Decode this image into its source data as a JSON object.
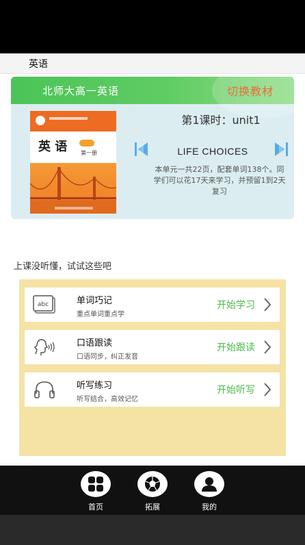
{
  "header": {
    "title": "英语"
  },
  "book": {
    "name": "北师大高一英语",
    "switch_label": "切换教材",
    "cover": {
      "title": "英 语",
      "volume": "第一册"
    },
    "lesson_title": "第1课时：unit1",
    "unit_name": "LIFE CHOICES",
    "description": "本单元一共22页，配套单词138个。同学们可以花17天来学习，并预留1到2天复习"
  },
  "practice": {
    "prompt": "上课没听懂，试试这些吧",
    "items": [
      {
        "title": "单词巧记",
        "subtitle": "重点单词重点学",
        "action": "开始学习",
        "icon": "abc-card-icon"
      },
      {
        "title": "口语跟读",
        "subtitle": "口语同步，纠正发音",
        "action": "开始跟读",
        "icon": "speaking-head-icon"
      },
      {
        "title": "听写练习",
        "subtitle": "听写结合，高效记忆",
        "action": "开始听写",
        "icon": "headphones-icon"
      }
    ]
  },
  "nav": {
    "items": [
      {
        "label": "首页",
        "icon": "home-grid-icon"
      },
      {
        "label": "拓展",
        "icon": "ball-icon"
      },
      {
        "label": "我的",
        "icon": "user-icon"
      }
    ]
  },
  "colors": {
    "accent_green": "#4cb94b",
    "switch_orange": "#f06a3a",
    "card_bg": "#dbedf0",
    "practice_bg": "#f5e3a6",
    "arrow_blue": "#5aa9e6"
  }
}
